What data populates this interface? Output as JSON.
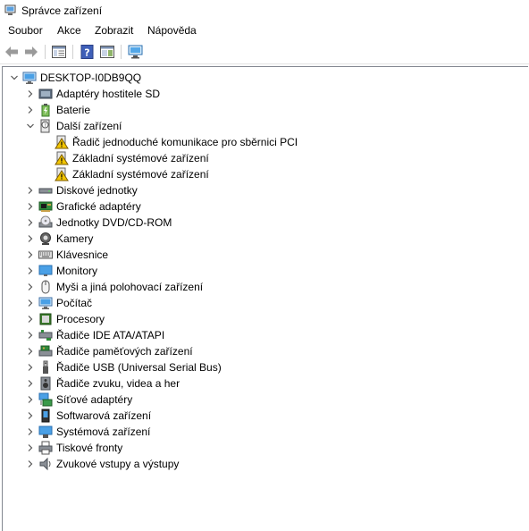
{
  "window": {
    "title": "Správce zařízení"
  },
  "menu": {
    "items": [
      "Soubor",
      "Akce",
      "Zobrazit",
      "Nápověda"
    ]
  },
  "tree": {
    "root": {
      "label": "DESKTOP-I0DB9QQ",
      "icon": "computer-icon"
    },
    "categories": [
      {
        "label": "Adaptéry hostitele SD",
        "icon": "sd-host-adapter-icon"
      },
      {
        "label": "Baterie",
        "icon": "battery-icon"
      },
      {
        "label": "Další zařízení",
        "icon": "unknown-device-icon",
        "children": [
          {
            "label": "Řadič jednoduché komunikace pro sběrnici PCI",
            "icon": "warning-device-icon"
          },
          {
            "label": "Základní systémové zařízení",
            "icon": "warning-device-icon"
          },
          {
            "label": "Základní systémové zařízení",
            "icon": "warning-device-icon"
          }
        ]
      },
      {
        "label": "Diskové jednotky",
        "icon": "disk-drive-icon"
      },
      {
        "label": "Grafické adaptéry",
        "icon": "display-adapter-icon"
      },
      {
        "label": "Jednotky DVD/CD-ROM",
        "icon": "dvd-drive-icon"
      },
      {
        "label": "Kamery",
        "icon": "camera-icon"
      },
      {
        "label": "Klávesnice",
        "icon": "keyboard-icon"
      },
      {
        "label": "Monitory",
        "icon": "monitor-icon"
      },
      {
        "label": "Myši a jiná polohovací zařízení",
        "icon": "mouse-icon"
      },
      {
        "label": "Počítač",
        "icon": "computer-icon"
      },
      {
        "label": "Procesory",
        "icon": "processor-icon"
      },
      {
        "label": "Řadiče IDE ATA/ATAPI",
        "icon": "ide-controller-icon"
      },
      {
        "label": "Řadiče paměťových zařízení",
        "icon": "storage-controller-icon"
      },
      {
        "label": "Řadiče USB (Universal Serial Bus)",
        "icon": "usb-icon"
      },
      {
        "label": "Řadiče zvuku, videa a her",
        "icon": "speaker-icon"
      },
      {
        "label": "Síťové adaptéry",
        "icon": "network-adapter-icon"
      },
      {
        "label": "Softwarová zařízení",
        "icon": "software-device-icon"
      },
      {
        "label": "Systémová zařízení",
        "icon": "system-device-icon"
      },
      {
        "label": "Tiskové fronty",
        "icon": "printer-icon"
      },
      {
        "label": "Zvukové vstupy a výstupy",
        "icon": "audio-io-icon"
      }
    ]
  },
  "colors": {
    "accent": "#0078d7",
    "warning": "#f2c500",
    "tree_border": "#828790"
  }
}
